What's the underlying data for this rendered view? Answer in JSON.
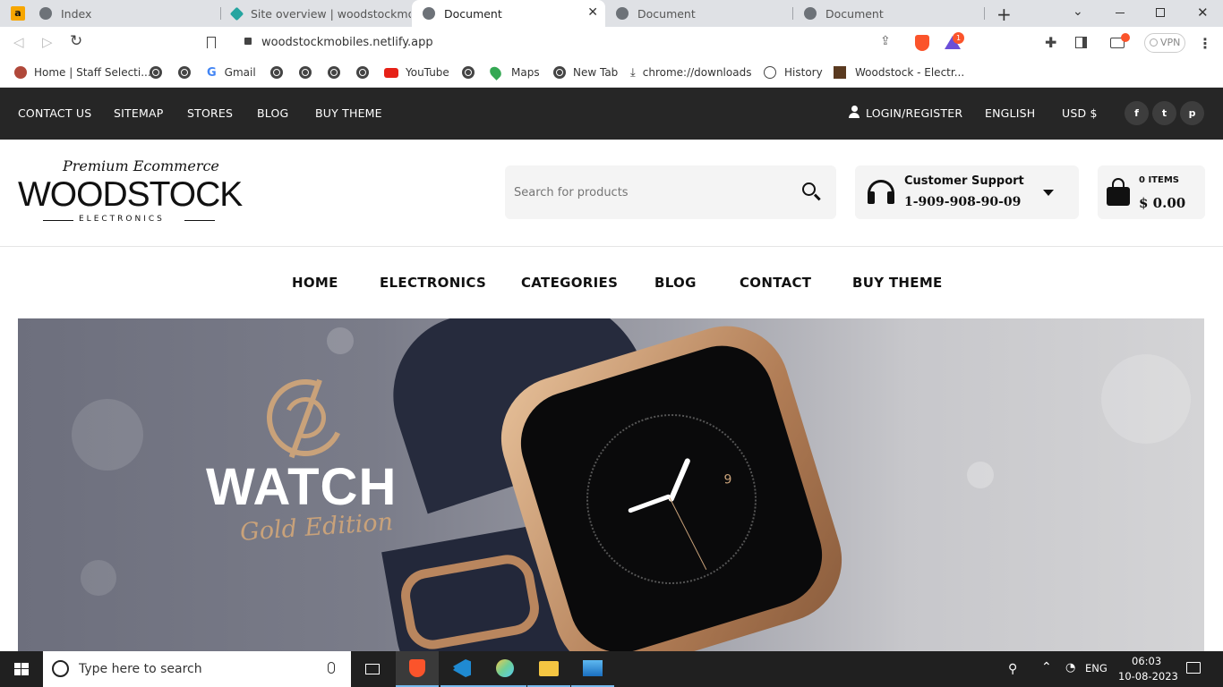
{
  "browser": {
    "tabs": [
      {
        "title": "Index",
        "active": false
      },
      {
        "title": "Site overview | woodstockmobiles",
        "active": false
      },
      {
        "title": "Document",
        "active": true
      },
      {
        "title": "Document",
        "active": false
      },
      {
        "title": "Document",
        "active": false
      }
    ],
    "address": "woodstockmobiles.netlify.app",
    "brave_badge": "1",
    "vpn_label": "VPN",
    "bookmarks": [
      {
        "label": "Home | Staff Selecti...",
        "icon": "staff-icon"
      },
      {
        "label": "",
        "icon": "globe-icon"
      },
      {
        "label": "",
        "icon": "globe-icon"
      },
      {
        "label": "Gmail",
        "icon": "google-icon"
      },
      {
        "label": "",
        "icon": "globe-icon"
      },
      {
        "label": "",
        "icon": "globe-icon"
      },
      {
        "label": "",
        "icon": "globe-icon"
      },
      {
        "label": "",
        "icon": "globe-icon"
      },
      {
        "label": "YouTube",
        "icon": "youtube-icon"
      },
      {
        "label": "",
        "icon": "globe-icon"
      },
      {
        "label": "Maps",
        "icon": "maps-icon"
      },
      {
        "label": "New Tab",
        "icon": "globe-icon"
      },
      {
        "label": "chrome://downloads",
        "icon": "download-icon"
      },
      {
        "label": "History",
        "icon": "history-icon"
      },
      {
        "label": "Woodstock - Electr...",
        "icon": "woodstock-icon"
      }
    ]
  },
  "topbar": {
    "links": [
      "CONTACT US",
      "SITEMAP",
      "STORES",
      "BLOG",
      "BUY THEME"
    ],
    "login": "LOGIN/REGISTER",
    "language": "ENGLISH",
    "currency": "USD $",
    "social": [
      "facebook-icon",
      "twitter-icon",
      "pinterest-icon"
    ]
  },
  "header": {
    "logo_tagline": "Premium Ecommerce",
    "logo_name": "WOODSTOCK",
    "logo_sub": "ELECTRONICS",
    "search_placeholder": "Search for products",
    "support_label": "Customer Support",
    "support_phone": "1-909-908-90-09",
    "cart_items": "0 ITEMS",
    "cart_total": "$ 0.00"
  },
  "nav": [
    "HOME",
    "ELECTRONICS",
    "CATEGORIES",
    "BLOG",
    "CONTACT",
    "BUY THEME"
  ],
  "hero": {
    "title": "WATCH",
    "subtitle": "Gold Edition",
    "watch_dial_number": "9"
  },
  "taskbar": {
    "search_placeholder": "Type here to search",
    "language": "ENG",
    "time": "06:03",
    "date": "10-08-2023"
  },
  "colors": {
    "topbar_bg": "#262626",
    "accent_gold": "#c9a27a",
    "brave_orange": "#fb542b"
  }
}
